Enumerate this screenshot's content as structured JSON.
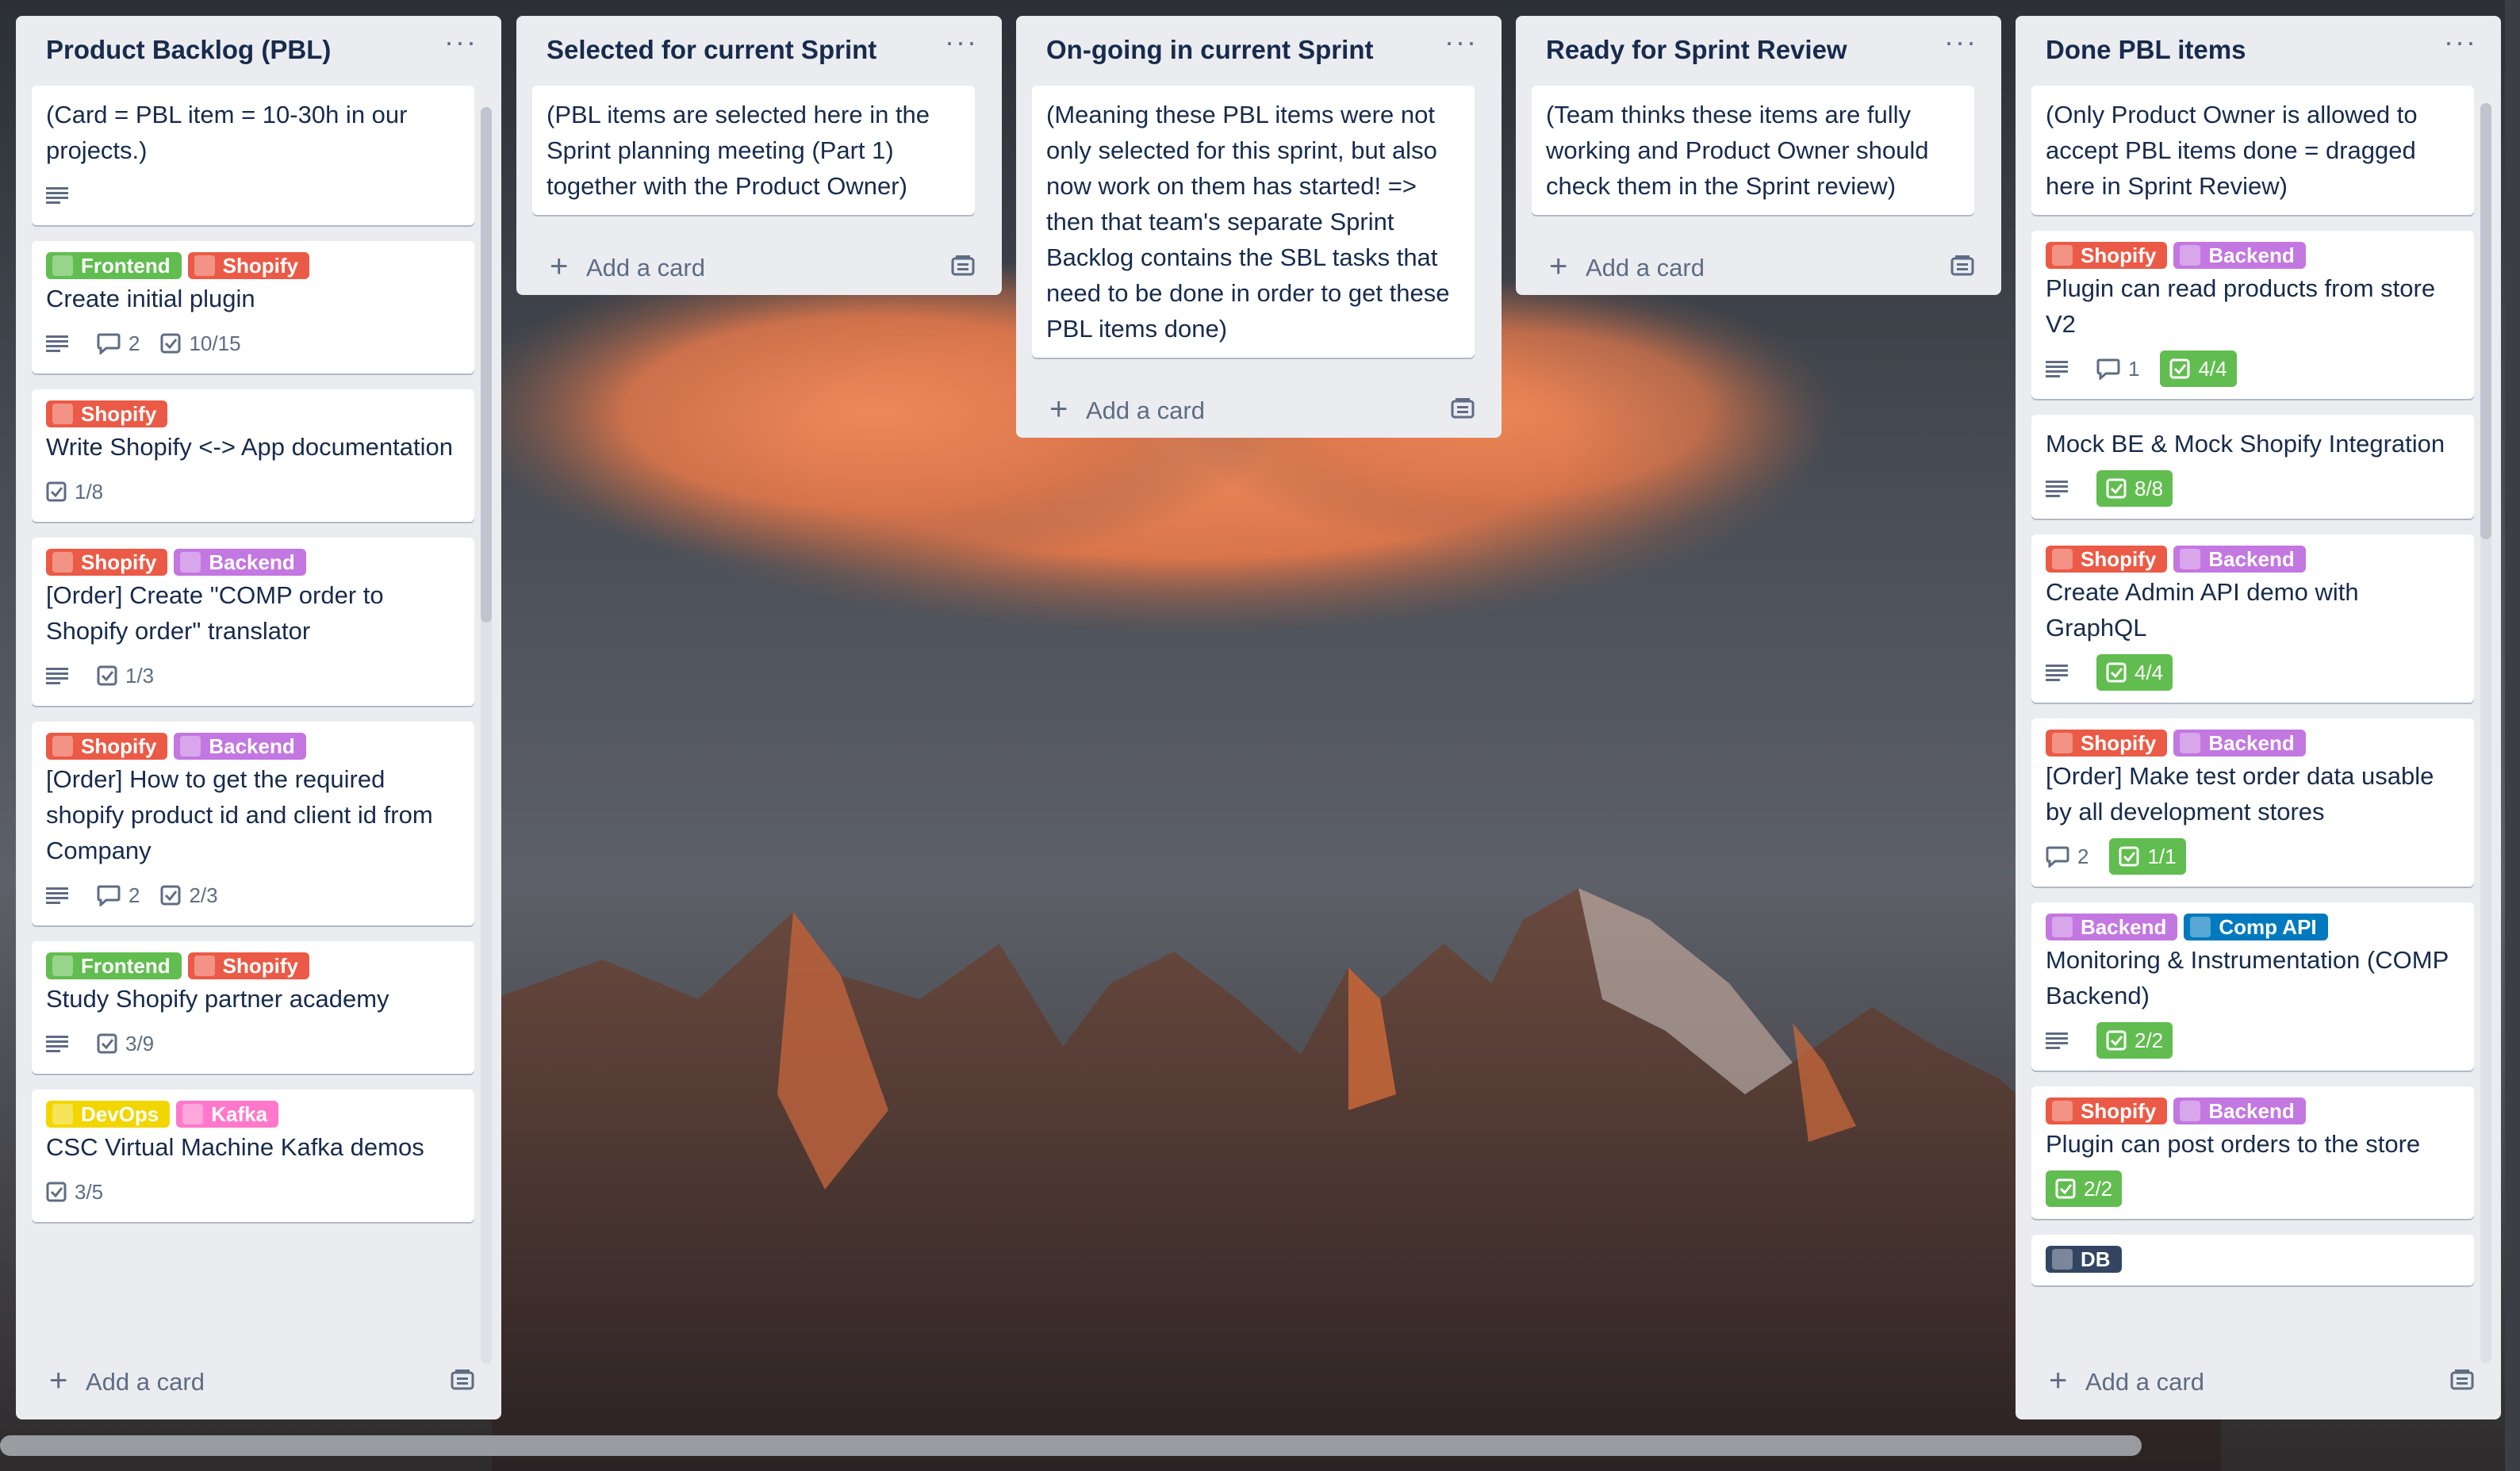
{
  "colors": {
    "list_bg": "#ebecf0",
    "text": "#172b4d",
    "muted": "#5e6c84",
    "green_label": "#61bd4f",
    "red_label": "#eb5a46",
    "purple_label": "#c377e0",
    "yellow_label": "#f2d600",
    "pink_label": "#ff78cb",
    "blue_label": "#0079bf",
    "navy_label": "#344563",
    "done_badge": "#61bd4f"
  },
  "add_card_label": "Add a card",
  "lists": [
    {
      "title": "Product Backlog (PBL)",
      "menu": "···",
      "cards": [
        {
          "title": "(Card = PBL item = 10-30h in our projects.)",
          "labels": [],
          "badges": {
            "description": true
          }
        },
        {
          "title": "Create initial plugin",
          "labels": [
            {
              "text": "Frontend",
              "color": "#61bd4f"
            },
            {
              "text": "Shopify",
              "color": "#eb5a46"
            }
          ],
          "badges": {
            "description": true,
            "comments": "2",
            "checklist": "10/15"
          }
        },
        {
          "title": "Write Shopify <-> App documentation",
          "labels": [
            {
              "text": "Shopify",
              "color": "#eb5a46"
            }
          ],
          "badges": {
            "checklist": "1/8"
          }
        },
        {
          "title": "[Order] Create \"COMP order to Shopify order\" translator",
          "labels": [
            {
              "text": "Shopify",
              "color": "#eb5a46"
            },
            {
              "text": "Backend",
              "color": "#c377e0"
            }
          ],
          "badges": {
            "description": true,
            "checklist": "1/3"
          }
        },
        {
          "title": "[Order] How to get the required shopify product id and client id from Company",
          "labels": [
            {
              "text": "Shopify",
              "color": "#eb5a46"
            },
            {
              "text": "Backend",
              "color": "#c377e0"
            }
          ],
          "badges": {
            "description": true,
            "comments": "2",
            "checklist": "2/3"
          }
        },
        {
          "title": "Study Shopify partner academy",
          "labels": [
            {
              "text": "Frontend",
              "color": "#61bd4f"
            },
            {
              "text": "Shopify",
              "color": "#eb5a46"
            }
          ],
          "badges": {
            "description": true,
            "checklist": "3/9"
          }
        },
        {
          "title": "CSC Virtual Machine Kafka demos",
          "labels": [
            {
              "text": "DevOps",
              "color": "#f2d600"
            },
            {
              "text": "Kafka",
              "color": "#ff78cb"
            }
          ],
          "badges": {
            "checklist": "3/5"
          }
        }
      ]
    },
    {
      "title": "Selected for current Sprint",
      "menu": "···",
      "cards": [
        {
          "title": "(PBL items are selected here in the Sprint planning meeting (Part 1) together with the Product Owner)",
          "labels": [],
          "badges": {}
        }
      ]
    },
    {
      "title": "On-going in current Sprint",
      "menu": "···",
      "cards": [
        {
          "title": "(Meaning these PBL items were not only selected for this sprint, but also now work on them has started! => then that team's separate Sprint Backlog contains the SBL tasks that need to be done in order to get these PBL items done)",
          "labels": [],
          "badges": {}
        }
      ]
    },
    {
      "title": "Ready for Sprint Review",
      "menu": "···",
      "cards": [
        {
          "title": "(Team thinks these items are fully working and Product Owner should check them in the Sprint review)",
          "labels": [],
          "badges": {}
        }
      ]
    },
    {
      "title": "Done PBL items",
      "menu": "···",
      "cards": [
        {
          "title": "(Only Product Owner is allowed to accept PBL items done = dragged here in Sprint Review)",
          "labels": [],
          "badges": {}
        },
        {
          "title": "Plugin can read products from store V2",
          "labels": [
            {
              "text": "Shopify",
              "color": "#eb5a46"
            },
            {
              "text": "Backend",
              "color": "#c377e0"
            }
          ],
          "badges": {
            "description": true,
            "comments": "1",
            "checklist_done": "4/4"
          }
        },
        {
          "title": "Mock BE & Mock Shopify Integration",
          "labels": [],
          "badges": {
            "description": true,
            "checklist_done": "8/8"
          }
        },
        {
          "title": "Create Admin API demo with GraphQL",
          "labels": [
            {
              "text": "Shopify",
              "color": "#eb5a46"
            },
            {
              "text": "Backend",
              "color": "#c377e0"
            }
          ],
          "badges": {
            "description": true,
            "checklist_done": "4/4"
          }
        },
        {
          "title": "[Order] Make test order data usable by all development stores",
          "labels": [
            {
              "text": "Shopify",
              "color": "#eb5a46"
            },
            {
              "text": "Backend",
              "color": "#c377e0"
            }
          ],
          "badges": {
            "comments": "2",
            "checklist_done": "1/1"
          }
        },
        {
          "title": "Monitoring & Instrumentation (COMP Backend)",
          "labels": [
            {
              "text": "Backend",
              "color": "#c377e0"
            },
            {
              "text": "Comp API",
              "color": "#0079bf"
            }
          ],
          "badges": {
            "description": true,
            "checklist_done": "2/2"
          }
        },
        {
          "title": "Plugin can post orders to the store",
          "labels": [
            {
              "text": "Shopify",
              "color": "#eb5a46"
            },
            {
              "text": "Backend",
              "color": "#c377e0"
            }
          ],
          "badges": {
            "checklist_done": "2/2"
          }
        },
        {
          "title": "",
          "labels": [
            {
              "text": "DB",
              "color": "#344563"
            }
          ],
          "badges": {}
        }
      ]
    }
  ]
}
